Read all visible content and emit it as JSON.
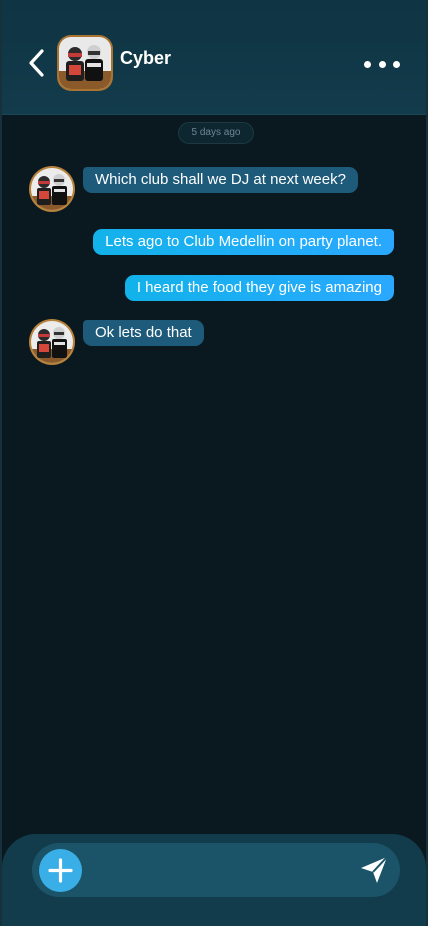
{
  "header": {
    "contact_name": "Cyber",
    "back_icon": "chevron-left-icon",
    "more_icon": "more-horizontal-icon"
  },
  "conversation": {
    "timestamp": "5 days ago",
    "messages": [
      {
        "direction": "incoming",
        "text": "Which club shall we DJ at next week?"
      },
      {
        "direction": "outgoing",
        "text": "Lets ago to Club Medellin on party planet."
      },
      {
        "direction": "outgoing",
        "text": "I heard the food they give is amazing"
      },
      {
        "direction": "incoming",
        "text": "Ok lets do that"
      }
    ]
  },
  "composer": {
    "input_value": "",
    "placeholder": "",
    "add_icon": "plus-icon",
    "send_icon": "send-icon"
  },
  "colors": {
    "background": "#0a1920",
    "header": "#123b4b",
    "incoming_bubble": "#1e5a7a",
    "outgoing_bubble": "#2aa8ff",
    "accent": "#3aaee6"
  }
}
